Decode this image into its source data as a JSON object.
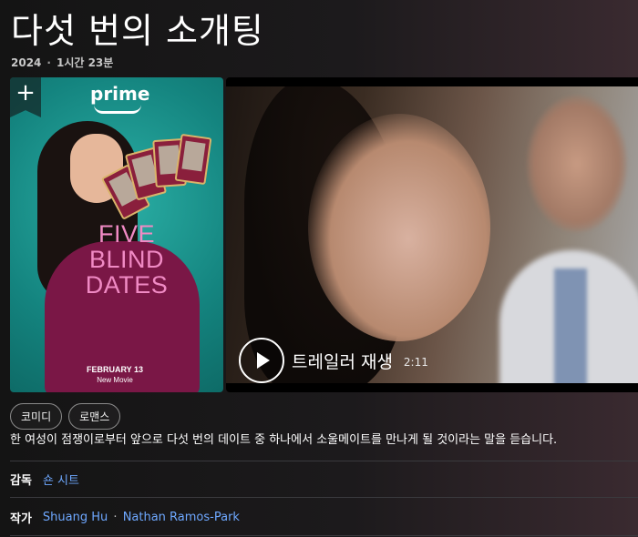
{
  "title": "다섯 번의 소개팅",
  "meta": {
    "year": "2024",
    "separator": "·",
    "duration": "1시간 23분"
  },
  "poster": {
    "bookmark_icon": "plus",
    "brand": "prime",
    "title_lines": [
      "FIVE",
      "BLIND",
      "DATES"
    ],
    "date": "FEBRUARY 13",
    "subtitle": "New Movie"
  },
  "trailer": {
    "play_label": "트레일러 재생",
    "duration": "2:11"
  },
  "genres": [
    "코미디",
    "로맨스"
  ],
  "description": "한 여성이 점쟁이로부터 앞으로 다섯 번의 데이트 중 하나에서 소울메이트를 만나게 될 것이라는 말을 듣습니다.",
  "director": {
    "label": "감독",
    "name": "숀 시트"
  },
  "writers": {
    "label": "작가",
    "names": [
      "Shuang Hu",
      "Nathan Ramos-Park"
    ],
    "separator": "·"
  },
  "colors": {
    "link": "#6ea8ff",
    "poster_bg": "#14847f",
    "poster_title": "#f08ac4"
  }
}
